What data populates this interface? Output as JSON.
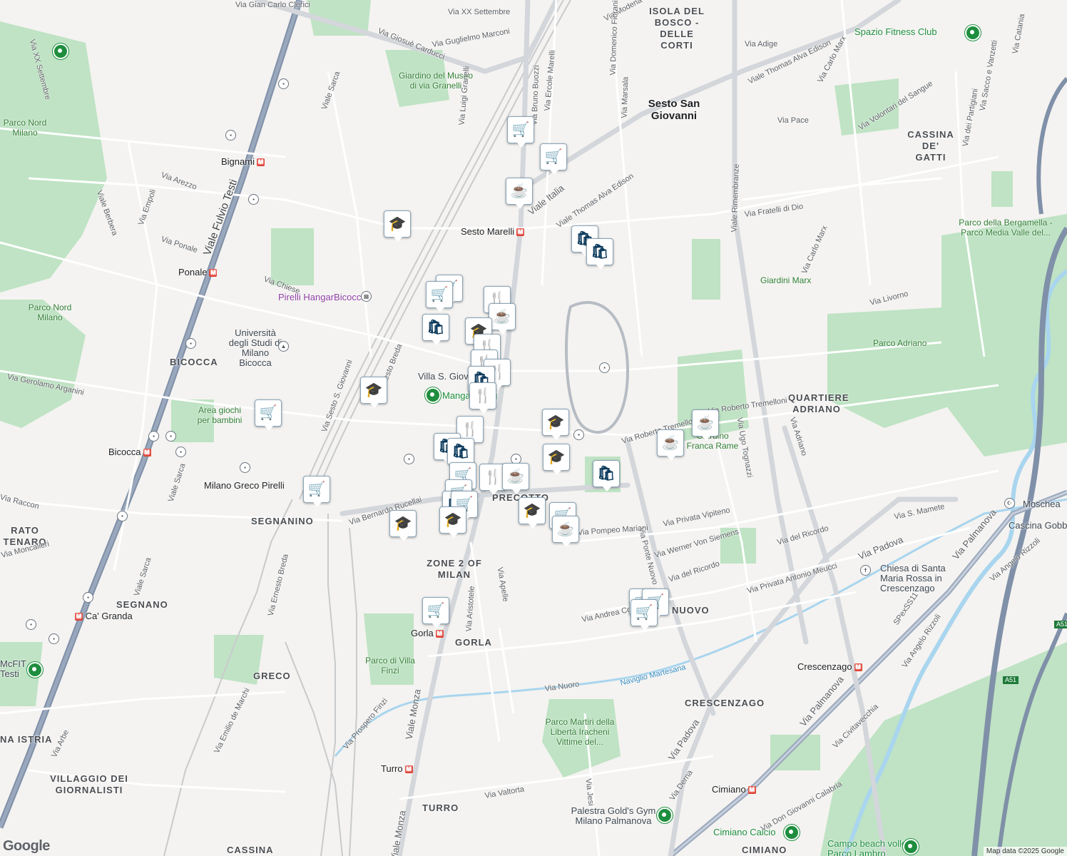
{
  "map": {
    "districts": [
      "ISOLA DEL BOSCO - DELLE CORTI",
      "CASSINA DE' GATTI",
      "BICOCCA",
      "QUARTIERE ADRIANO",
      "SEGNANINO",
      "SEGNANO",
      "ZONE 2 OF MILAN",
      "GORLA",
      "GRECO",
      "CRESCENZAGO",
      "VILLAGGIO DEI GIORNALISTI",
      "TURRO",
      "CASSINA",
      "CIMIANO",
      "PRECOTTO",
      "NUOVO",
      "NA ISTRIA",
      "RATO TENARO"
    ],
    "city": "Sesto San Giovanni",
    "streets": [
      "Via Gian Carlo Clerici",
      "Via XX Settembre",
      "Via Giosuè Carducci",
      "Via Guglielmo Marconi",
      "Via Modena",
      "Via Adige",
      "Viale Thomas Alva Edison",
      "Via Carlo Marx",
      "Via Catania",
      "Via Sacco e Vanzetti",
      "Viale Fulvio Testi",
      "Viale Sarca",
      "Via Luigi Granelli",
      "Via Bruno Buozzi",
      "Via Ercole Marelli",
      "Via Domenico Fiorani",
      "Via Marsala",
      "Via Pace",
      "Via Volontari del Sangue",
      "Via dei Partigiani",
      "Via Arezzo",
      "Via Empoli",
      "Viale Berbera",
      "Via Ponale",
      "Via Chiese",
      "Viale Italia",
      "Viale Rimembranze",
      "Via Fratelli di Dio",
      "Via Livorno",
      "Via Gerolamo Arganini",
      "Via Sesto S. Giovanni",
      "Via Ernesto Breda",
      "Via Roberto Tremelloni",
      "Via Ugo Tognazzi",
      "Via Adriano",
      "Via Bernardo Rucellai",
      "Via Pompeo Mariani",
      "Via Privata Vipiteno",
      "Via Ponte Nuovo",
      "Via Werner Von Siemens",
      "Via del Ricordo",
      "Via S. Mamete",
      "Via Padova",
      "Via Privata Antonio Meucci",
      "Via Andrea Costa",
      "Via Aristotele",
      "Via Apelle",
      "Via Moncalieri",
      "Viale Monza",
      "Via Nuoro",
      "Naviglio Martesana",
      "Via Prospero Finzi",
      "Via Emilio de Marchi",
      "Via Arbe",
      "Via Valtorta",
      "Via Jesi",
      "Via Derna",
      "Via Don Giovanni Calabria",
      "Via Civitavecchia",
      "Via Angelo Rizzoli",
      "Via Palmanova",
      "SPexSS11",
      "Via Raccon"
    ],
    "parks": [
      "Giardino del Museo di via Granelli",
      "Parco Nord Milano",
      "Parco della Bergamella - Parco Media Valle del...",
      "Giardini Marx",
      "Parco Adriano",
      "Area giochi per bambini",
      "Parco di Villa Finzi",
      "Parco Martiri della Libertà Iracheni Vittime del...",
      "Giardino Franca Rame"
    ],
    "pois": [
      "Spazio Fitness Club",
      "Pirelli HangarBicocca",
      "Università degli Studi di Milano Bicocca",
      "Villa S. Giovanni",
      "Mangafishing",
      "Moschea",
      "Cascina Gobba",
      "Chiesa di Santa Maria Rossa in Crescenzago",
      "McFIT Testi",
      "Palestra Gold's Gym Milano Palmanova",
      "Cimiano Calcio",
      "Campo beach volley Parco Lambro"
    ],
    "stations": [
      "Bignami",
      "Sesto Marelli",
      "Ponale",
      "Bicocca",
      "Milano Greco Pirelli",
      "Ca' Granda",
      "Gorla",
      "Crescenzago",
      "Turro",
      "Cimiano"
    ],
    "road_shields": [
      "A51",
      "A51"
    ],
    "attribution": "Map data ©2025 Google",
    "logo": "Google"
  }
}
